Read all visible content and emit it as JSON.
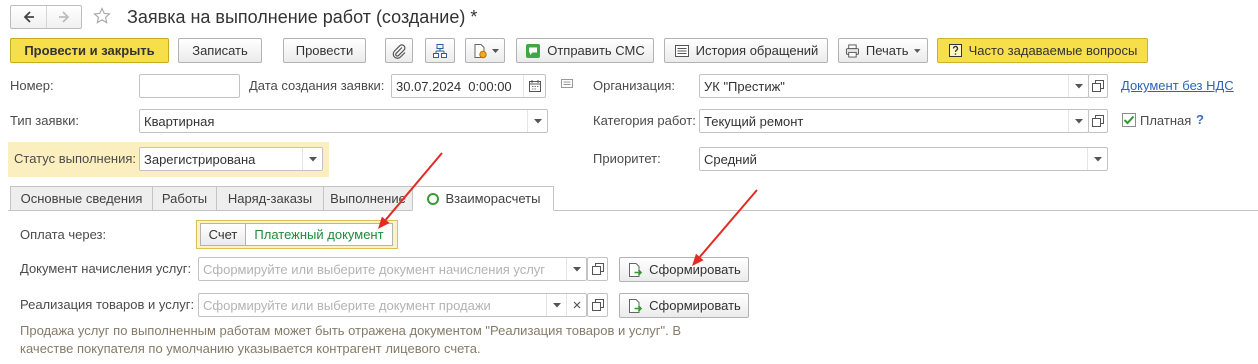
{
  "window": {
    "title": "Заявка на выполнение работ (создание) *",
    "icons": {
      "back": "arrow-left-icon",
      "forward": "arrow-right-icon",
      "favorite": "star-icon"
    }
  },
  "toolbar": {
    "post_and_close": "Провести и закрыть",
    "save": "Записать",
    "post": "Провести",
    "send_sms": "Отправить СМС",
    "history": "История обращений",
    "print": "Печать",
    "faq": "Часто задаваемые вопросы",
    "icons": {
      "attach": "paperclip-icon",
      "structure": "structure-icon",
      "create_based_on": "document-gear-icon",
      "send_sms": "sms-icon",
      "history": "list-icon",
      "print": "printer-icon",
      "faq": "question-icon"
    }
  },
  "header": {
    "number": {
      "label": "Номер:",
      "value": ""
    },
    "created_date": {
      "label": "Дата создания заявки:",
      "value": "30.07.2024  0:00:00",
      "icon": "calendar-icon"
    },
    "organization": {
      "label": "Организация:",
      "value": "УК \"Престиж\""
    },
    "no_vat_link": "Документ без НДС",
    "request_type": {
      "label": "Тип заявки:",
      "value": "Квартирная"
    },
    "work_category": {
      "label": "Категория работ:",
      "value": "Текущий ремонт"
    },
    "paid": {
      "label": "Платная",
      "checked": true,
      "help": "?"
    },
    "status": {
      "label": "Статус выполнения:",
      "value": "Зарегистрирована"
    },
    "priority": {
      "label": "Приоритет:",
      "value": "Средний"
    }
  },
  "tabs": [
    {
      "label": "Основные сведения",
      "active": false
    },
    {
      "label": "Работы",
      "active": false
    },
    {
      "label": "Наряд-заказы",
      "active": false
    },
    {
      "label": "Выполнение",
      "active": false
    },
    {
      "label": "Взаиморасчеты",
      "active": true,
      "icon": "green-circle-icon"
    }
  ],
  "settlements": {
    "payment_via": {
      "label": "Оплата через:",
      "options": [
        "Счет",
        "Платежный документ"
      ],
      "selected_index": 1
    },
    "accrual_document": {
      "label": "Документ начисления услуг:",
      "placeholder": "Сформируйте или выберите документ начисления услуг",
      "action": "Сформировать"
    },
    "sales_document": {
      "label": "Реализация товаров и услуг:",
      "placeholder": "Сформируйте или выберите документ продажи",
      "action": "Сформировать"
    },
    "hint": [
      "Продажа услуг по выполненным работам может быть отражена документом \"Реализация товаров и услуг\". В",
      "качестве покупателя по умолчанию указывается контрагент лицевого счета."
    ]
  },
  "colors": {
    "primary_button": "#f7df4b",
    "status_highlight": "#fcefbf",
    "link": "#2f62b5",
    "help": "#3a6ec6",
    "selected_option_text": "#1e8c3a",
    "hint_text": "#857b68",
    "annotation_arrow": "#e32b22"
  }
}
